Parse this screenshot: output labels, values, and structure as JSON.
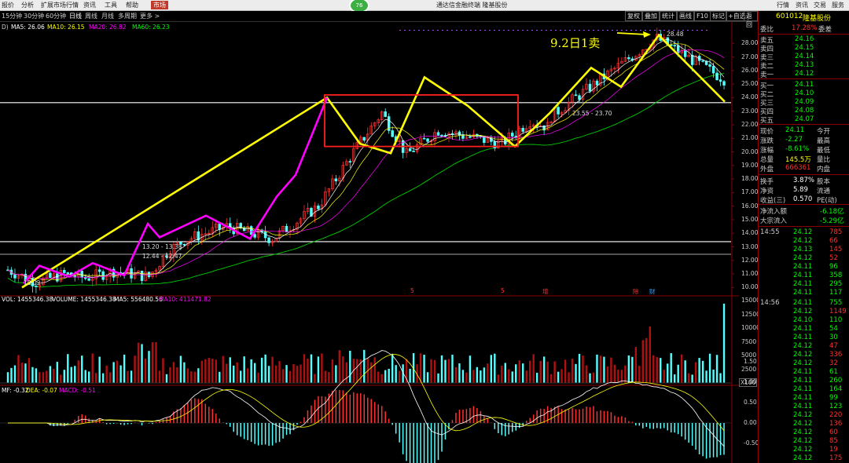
{
  "menu": {
    "items": [
      "报价",
      "分析",
      "扩展市场行情",
      "资讯",
      "工具",
      "帮助",
      "市场"
    ],
    "badge": "76",
    "title": "通达信金融终端 隆基股份",
    "right_items": [
      "行情",
      "资讯",
      "交易",
      "服务"
    ]
  },
  "period_bar": {
    "items": [
      "15分钟",
      "30分钟",
      "60分钟",
      "日线",
      "周线",
      "月线",
      "多周期",
      "更多 >"
    ],
    "active": "日线",
    "tools": [
      "复权",
      "叠加",
      "统计",
      "画线",
      "F10",
      "标记",
      "+自选",
      "返回"
    ]
  },
  "main_chart": {
    "ma_legend": [
      {
        "text": "MA5: 26.06",
        "color": "#ffffff"
      },
      {
        "text": "MA10: 26.15",
        "color": "#ffff00"
      },
      {
        "text": "MA20: 26.82",
        "color": "#ff00ff"
      },
      {
        "text": "MA60: 26.23",
        "color": "#00ff00"
      }
    ],
    "left_marker": "D)",
    "y_ticks": [
      "28.00",
      "27.00",
      "26.00",
      "25.00",
      "24.00",
      "23.00",
      "22.00",
      "21.00",
      "20.00",
      "19.00",
      "18.00",
      "17.00",
      "16.00",
      "15.00",
      "14.00",
      "13.00",
      "12.00",
      "11.00",
      "10.00"
    ],
    "high_label": "28.48",
    "low_label": "10.02",
    "annotation": "9.2日1卖",
    "range_label_1": "13.20 - 13.38",
    "range_label_2": "12.44 - 12.47",
    "range_label_3": "23.55 - 23.70",
    "event_markers": [
      {
        "text": "5",
        "color": "#ff3030"
      },
      {
        "text": "5",
        "color": "#ff3030"
      },
      {
        "text": "增",
        "color": "#ff3030"
      },
      {
        "text": "除",
        "color": "#ff3030"
      },
      {
        "text": "财",
        "color": "#30a0ff"
      }
    ]
  },
  "volume_panel": {
    "legend": [
      {
        "text": "VOL: 1455346.38",
        "color": "#ffffff"
      },
      {
        "text": "VOLUME: 1455346.38",
        "color": "#ffffff"
      },
      {
        "text": "MA5: 556480.56",
        "color": "#ffffff"
      },
      {
        "text": "MA10: 411471.82",
        "color": "#ff00ff"
      }
    ],
    "y_ticks": [
      "15000",
      "12500",
      "10000",
      "7500",
      "5000",
      "2500"
    ],
    "unit": "X100"
  },
  "macd_panel": {
    "legend": [
      {
        "text": "MF: -0.32",
        "color": "#ffffff"
      },
      {
        "text": "DEA: -0.07",
        "color": "#ffff00"
      },
      {
        "text": "MACD: -0.51",
        "color": "#ff00ff"
      }
    ],
    "y_ticks": [
      "1.50",
      "1.00",
      "0.50",
      "0.00",
      "-0.50"
    ]
  },
  "quote_panel": {
    "code": "601012",
    "name": "隆基股份",
    "weibi_label": "委比",
    "weibi_value": "17.28%",
    "weicha_label": "委差",
    "asks": [
      {
        "label": "卖五",
        "price": "24.16"
      },
      {
        "label": "卖四",
        "price": "24.15"
      },
      {
        "label": "卖三",
        "price": "24.14"
      },
      {
        "label": "卖二",
        "price": "24.13"
      },
      {
        "label": "卖一",
        "price": "24.12"
      }
    ],
    "bids": [
      {
        "label": "买一",
        "price": "24.11"
      },
      {
        "label": "买二",
        "price": "24.10"
      },
      {
        "label": "买三",
        "price": "24.09"
      },
      {
        "label": "买四",
        "price": "24.08"
      },
      {
        "label": "买五",
        "price": "24.07"
      }
    ],
    "stats": [
      {
        "l1": "现价",
        "v1": "24.11",
        "l2": "今开",
        "c1": "#00ff00"
      },
      {
        "l1": "涨跌",
        "v1": "-2.27",
        "l2": "最高",
        "c1": "#00ff00"
      },
      {
        "l1": "涨幅",
        "v1": "-8.61%",
        "l2": "最低",
        "c1": "#00ff00"
      },
      {
        "l1": "总量",
        "v1": "145.5万",
        "l2": "量比",
        "c1": "#ffff00"
      },
      {
        "l1": "外盘",
        "v1": "666361",
        "l2": "内盘",
        "c1": "#ff3030"
      }
    ],
    "stats2": [
      {
        "l1": "换手",
        "v1": "3.87%",
        "l2": "股本"
      },
      {
        "l1": "净资",
        "v1": "5.89",
        "l2": "流通"
      },
      {
        "l1": "收益(三)",
        "v1": "0.570",
        "l2": "PE(动)"
      }
    ],
    "flow": [
      {
        "label": "净流入额",
        "value": "-6.18亿"
      },
      {
        "label": "大宗流入",
        "value": "-5.29亿"
      }
    ],
    "ticks": [
      {
        "time": "14:55",
        "price": "24.12",
        "vol": "785"
      },
      {
        "time": "",
        "price": "24.12",
        "vol": "66"
      },
      {
        "time": "",
        "price": "24.13",
        "vol": "145"
      },
      {
        "time": "",
        "price": "24.12",
        "vol": "52"
      },
      {
        "time": "",
        "price": "24.11",
        "vol": "96"
      },
      {
        "time": "",
        "price": "24.11",
        "vol": "358"
      },
      {
        "time": "",
        "price": "24.11",
        "vol": "295"
      },
      {
        "time": "",
        "price": "24.11",
        "vol": "117"
      },
      {
        "time": "14:56",
        "price": "24.11",
        "vol": "755"
      },
      {
        "time": "",
        "price": "24.12",
        "vol": "1149"
      },
      {
        "time": "",
        "price": "24.10",
        "vol": "110"
      },
      {
        "time": "",
        "price": "24.11",
        "vol": "54"
      },
      {
        "time": "",
        "price": "24.11",
        "vol": "30"
      },
      {
        "time": "",
        "price": "24.12",
        "vol": "47"
      },
      {
        "time": "",
        "price": "24.12",
        "vol": "336"
      },
      {
        "time": "",
        "price": "24.12",
        "vol": "32"
      },
      {
        "time": "",
        "price": "24.11",
        "vol": "61"
      },
      {
        "time": "",
        "price": "24.11",
        "vol": "260"
      },
      {
        "time": "",
        "price": "24.11",
        "vol": "164"
      },
      {
        "time": "",
        "price": "24.11",
        "vol": "99"
      },
      {
        "time": "",
        "price": "24.11",
        "vol": "123"
      },
      {
        "time": "",
        "price": "24.12",
        "vol": "220"
      },
      {
        "time": "",
        "price": "24.12",
        "vol": "136"
      },
      {
        "time": "",
        "price": "24.12",
        "vol": "60"
      },
      {
        "time": "",
        "price": "24.12",
        "vol": "85"
      },
      {
        "time": "",
        "price": "24.12",
        "vol": "19"
      },
      {
        "time": "",
        "price": "24.12",
        "vol": "175"
      }
    ]
  },
  "colors": {
    "up": "#ff3030",
    "down": "#54ffff",
    "trend_yellow": "#ffff00",
    "trend_magenta": "#ff00ff",
    "box_red": "#ff2020"
  }
}
